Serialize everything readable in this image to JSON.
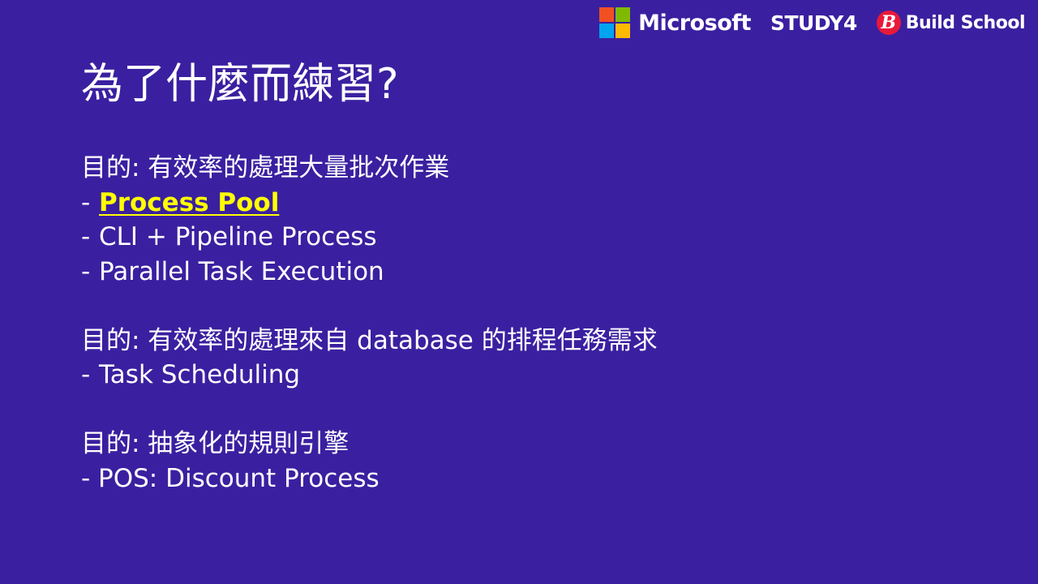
{
  "logos": {
    "microsoft": "Microsoft",
    "study4": "STUDY4",
    "build_school_badge": "B",
    "build_school": "Build School",
    "microsoft_colors": [
      "#f25022",
      "#7fba00",
      "#00a4ef",
      "#ffb900"
    ]
  },
  "slide": {
    "title": "為了什麼而練習?",
    "sections": [
      {
        "heading": "目的: 有效率的處理大量批次作業",
        "items": [
          {
            "dash": "-",
            "text": "Process Pool"
          },
          {
            "dash": "-",
            "text": "CLI + Pipeline Process"
          },
          {
            "dash": "-",
            "text": "Parallel Task Execution"
          }
        ]
      },
      {
        "heading": "目的: 有效率的處理來自 database 的排程任務需求",
        "items": [
          {
            "dash": "-",
            "text": "Task Scheduling"
          }
        ]
      },
      {
        "heading": "目的: 抽象化的規則引擎",
        "items": [
          {
            "text": "- POS: Discount Process"
          }
        ]
      }
    ]
  },
  "colors": {
    "background": "#3a20a0",
    "text": "#ffffff",
    "highlight": "#ffff00"
  }
}
